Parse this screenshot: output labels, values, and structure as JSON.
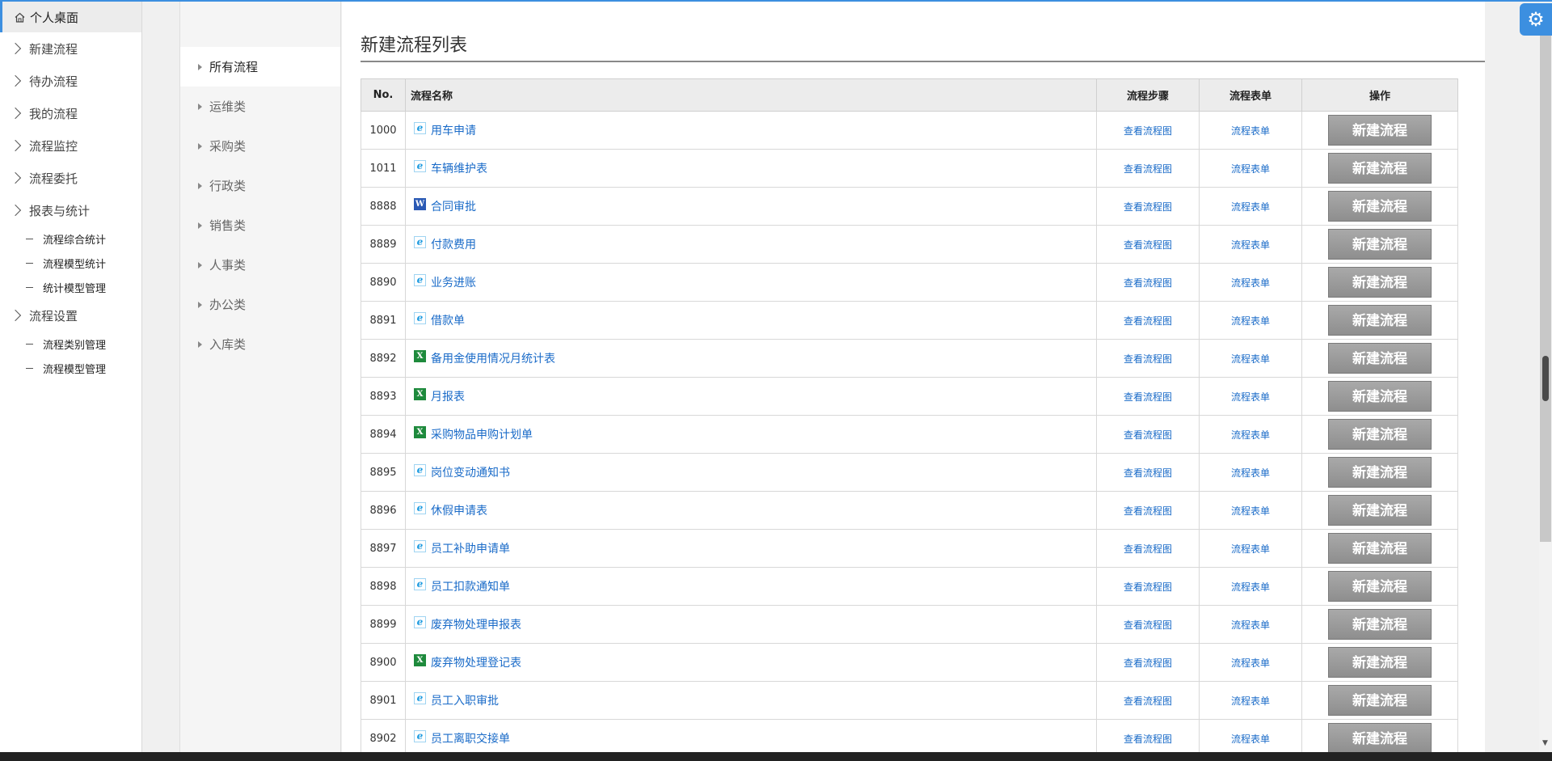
{
  "sidebar": {
    "home": "个人桌面",
    "items": [
      {
        "label": "新建流程"
      },
      {
        "label": "待办流程"
      },
      {
        "label": "我的流程"
      },
      {
        "label": "流程监控"
      },
      {
        "label": "流程委托"
      },
      {
        "label": "报表与统计",
        "subs": [
          "流程综合统计",
          "流程模型统计",
          "统计模型管理"
        ]
      },
      {
        "label": "流程设置",
        "subs": [
          "流程类别管理",
          "流程模型管理"
        ]
      }
    ]
  },
  "categories": [
    "所有流程",
    "运维类",
    "采购类",
    "行政类",
    "销售类",
    "人事类",
    "办公类",
    "入库类"
  ],
  "main": {
    "title": "新建流程列表",
    "headers": {
      "no": "No.",
      "name": "流程名称",
      "step": "流程步骤",
      "form": "流程表单",
      "op": "操作"
    },
    "rows": [
      {
        "no": "1000",
        "name": "用车申请",
        "icon": "ie-icon",
        "step": "查看流程图",
        "form": "流程表单",
        "op": "新建流程"
      },
      {
        "no": "1011",
        "name": "车辆维护表",
        "icon": "ie-icon",
        "step": "查看流程图",
        "form": "流程表单",
        "op": "新建流程"
      },
      {
        "no": "8888",
        "name": "合同审批",
        "icon": "word-icon",
        "step": "查看流程图",
        "form": "流程表单",
        "op": "新建流程"
      },
      {
        "no": "8889",
        "name": "付款费用",
        "icon": "ie-icon",
        "step": "查看流程图",
        "form": "流程表单",
        "op": "新建流程"
      },
      {
        "no": "8890",
        "name": "业务进账",
        "icon": "ie-icon",
        "step": "查看流程图",
        "form": "流程表单",
        "op": "新建流程"
      },
      {
        "no": "8891",
        "name": "借款单",
        "icon": "ie-icon",
        "step": "查看流程图",
        "form": "流程表单",
        "op": "新建流程"
      },
      {
        "no": "8892",
        "name": "备用金使用情况月统计表",
        "icon": "excel-icon",
        "step": "查看流程图",
        "form": "流程表单",
        "op": "新建流程"
      },
      {
        "no": "8893",
        "name": "月报表",
        "icon": "excel-icon",
        "step": "查看流程图",
        "form": "流程表单",
        "op": "新建流程"
      },
      {
        "no": "8894",
        "name": "采购物品申购计划单",
        "icon": "excel-icon",
        "step": "查看流程图",
        "form": "流程表单",
        "op": "新建流程"
      },
      {
        "no": "8895",
        "name": "岗位变动通知书",
        "icon": "ie-icon",
        "step": "查看流程图",
        "form": "流程表单",
        "op": "新建流程"
      },
      {
        "no": "8896",
        "name": "休假申请表",
        "icon": "ie-icon",
        "step": "查看流程图",
        "form": "流程表单",
        "op": "新建流程"
      },
      {
        "no": "8897",
        "name": "员工补助申请单",
        "icon": "ie-icon",
        "step": "查看流程图",
        "form": "流程表单",
        "op": "新建流程"
      },
      {
        "no": "8898",
        "name": "员工扣款通知单",
        "icon": "ie-icon",
        "step": "查看流程图",
        "form": "流程表单",
        "op": "新建流程"
      },
      {
        "no": "8899",
        "name": "废弃物处理申报表",
        "icon": "ie-icon",
        "step": "查看流程图",
        "form": "流程表单",
        "op": "新建流程"
      },
      {
        "no": "8900",
        "name": "废弃物处理登记表",
        "icon": "excel-icon",
        "step": "查看流程图",
        "form": "流程表单",
        "op": "新建流程"
      },
      {
        "no": "8901",
        "name": "员工入职审批",
        "icon": "ie-icon",
        "step": "查看流程图",
        "form": "流程表单",
        "op": "新建流程"
      },
      {
        "no": "8902",
        "name": "员工离职交接单",
        "icon": "ie-icon",
        "step": "查看流程图",
        "form": "流程表单",
        "op": "新建流程"
      }
    ]
  },
  "icons": {
    "home": "home-icon",
    "settings": "gear-icon"
  },
  "colors": {
    "accent": "#3c8fe0",
    "link": "#1a6bc8",
    "button": "#999999"
  }
}
